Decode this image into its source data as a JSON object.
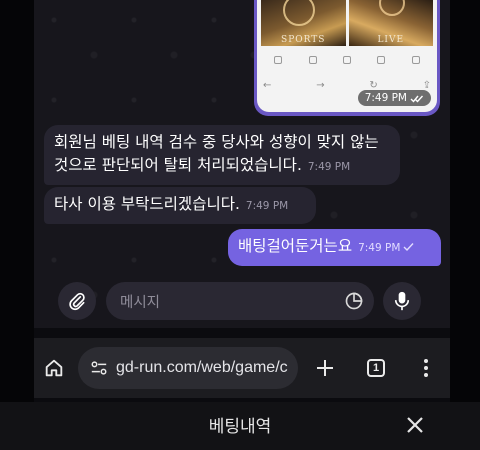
{
  "media_message": {
    "tiles": [
      "SPORTS",
      "LIVE"
    ],
    "time": "7:49 PM",
    "status_icon": "double-check-icon"
  },
  "messages": [
    {
      "direction": "incoming",
      "text": "회원님 베팅 내역 검수 중 당사와 성향이 맞지 않는것으로 판단되어 탈퇴 처리되었습니다.",
      "time": "7:49 PM"
    },
    {
      "direction": "incoming",
      "text": "타사 이용 부탁드리겠습니다.",
      "time": "7:49 PM"
    },
    {
      "direction": "outgoing",
      "text": "배팅걸어둔거는요",
      "time": "7:49 PM",
      "status_icon": "single-check-icon"
    }
  ],
  "composer": {
    "placeholder": "메시지",
    "icons": [
      "paperclip-icon",
      "sticker-icon",
      "mic-icon"
    ]
  },
  "browser": {
    "url": "gd-run.com/web/game/c",
    "tab_count": "1",
    "icons": [
      "home-icon",
      "site-settings-icon",
      "plus-icon",
      "tabs-icon",
      "more-vert-icon"
    ]
  },
  "sheet": {
    "title": "베팅내역",
    "close_icon": "close-icon"
  },
  "colors": {
    "outgoing_bubble": "#7563e1",
    "incoming_bubble": "#262430",
    "chat_background": "#17161c"
  }
}
